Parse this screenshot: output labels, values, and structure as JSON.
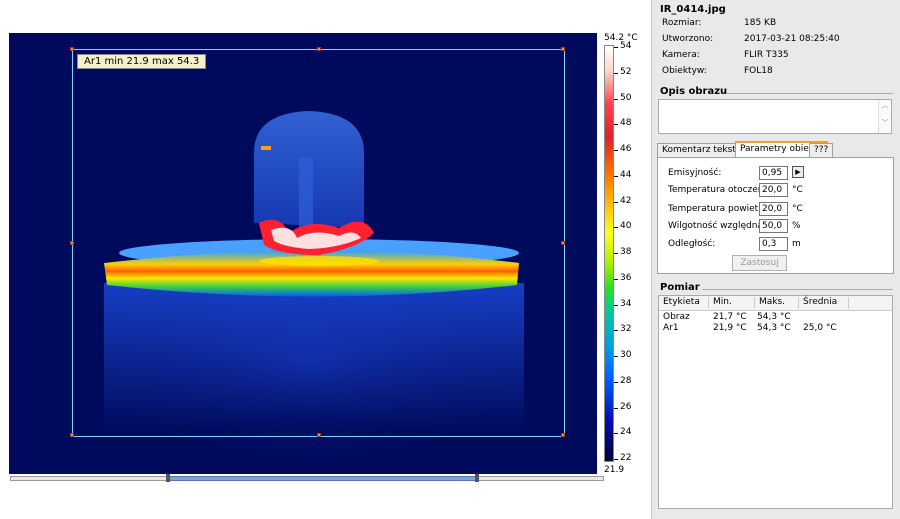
{
  "roi_label": "Ar1 min 21.9 max 54.3",
  "scale": {
    "top_label": "54.2 °C",
    "bottom_label": "21.9",
    "ticks": [
      "54",
      "52",
      "50",
      "48",
      "46",
      "44",
      "42",
      "40",
      "38",
      "36",
      "34",
      "32",
      "30",
      "28",
      "26",
      "24",
      "22"
    ]
  },
  "file": {
    "name": "IR_0414.jpg",
    "rows": [
      {
        "key": "Rozmiar:",
        "value": "185 KB"
      },
      {
        "key": "Utworzono:",
        "value": "2017-03-21 08:25:40"
      },
      {
        "key": "Kamera:",
        "value": "FLIR T335"
      },
      {
        "key": "Obiektyw:",
        "value": "FOL18"
      }
    ]
  },
  "description": {
    "title": "Opis obrazu",
    "value": ""
  },
  "tabs": [
    "Komentarz tekstowy",
    "Parametry obiektu",
    "???"
  ],
  "params": {
    "rows": [
      {
        "label": "Emisyjność:",
        "value": "0,95",
        "unit": ""
      },
      {
        "label": "Temperatura otoczenia:",
        "value": "20,0",
        "unit": "°C"
      },
      {
        "label": "Temperatura powietrza:",
        "value": "20,0",
        "unit": "°C"
      },
      {
        "label": "Wilgotność względna:",
        "value": "50,0",
        "unit": "%"
      },
      {
        "label": "Odległość:",
        "value": "0,3",
        "unit": "m"
      }
    ],
    "apply_label": "Zastosuj"
  },
  "measurement": {
    "title": "Pomiar",
    "columns": [
      "Etykieta",
      "Min.",
      "Maks.",
      "Średnia"
    ],
    "rows": [
      [
        "Obraz",
        "21,7 °C",
        "54,3 °C",
        ""
      ],
      [
        "Ar1",
        "21,9 °C",
        "54,3 °C",
        "25,0 °C"
      ]
    ]
  }
}
